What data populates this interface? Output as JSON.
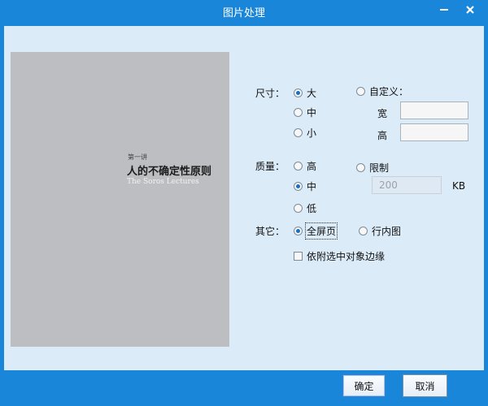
{
  "window": {
    "title": "图片处理"
  },
  "preview": {
    "subtitle": "第一讲",
    "heading": "人的不确定性原则",
    "english": "The Soros Lectures"
  },
  "size": {
    "label": "尺寸：",
    "options": [
      "大",
      "中",
      "小"
    ],
    "selected": "大",
    "custom_label": "自定义：",
    "width_label": "宽",
    "height_label": "高",
    "width_value": "",
    "height_value": ""
  },
  "quality": {
    "label": "质量：",
    "options": [
      "高",
      "中",
      "低"
    ],
    "selected": "中",
    "limit_label": "限制",
    "limit_value": "200",
    "unit": "KB"
  },
  "other": {
    "label": "其它：",
    "options": [
      "全屏页",
      "行内图"
    ],
    "selected": "全屏页",
    "checkbox_label": "依附选中对象边缘",
    "checkbox_checked": false
  },
  "buttons": {
    "ok": "确定",
    "cancel": "取消"
  }
}
